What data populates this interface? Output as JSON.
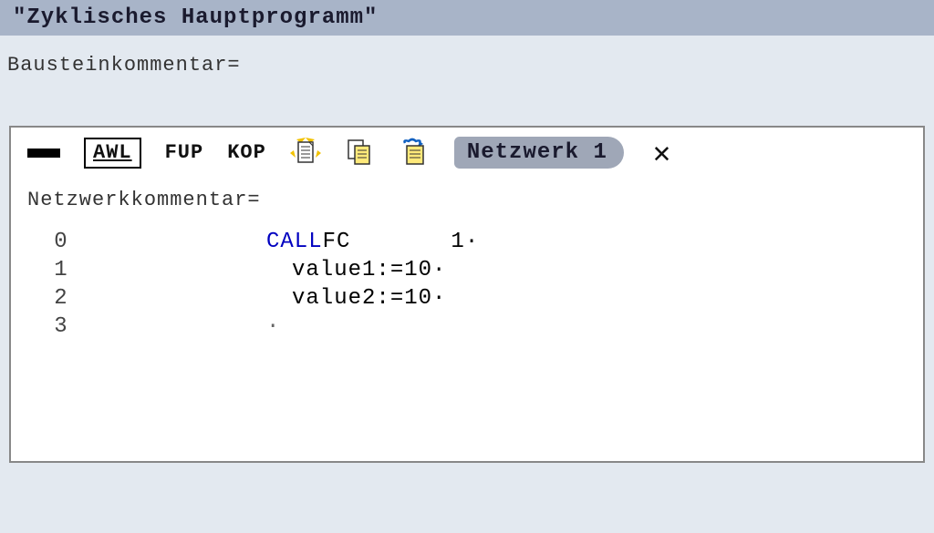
{
  "title": "\"Zyklisches Hauptprogramm\"",
  "block_comment_label": "Bausteinkommentar=",
  "block_comment_value": "",
  "toolbar": {
    "awl": "AWL",
    "fup": "FUP",
    "kop": "KOP",
    "network_tab": "Netzwerk 1",
    "close": "✕"
  },
  "network_comment_label": "Netzwerkkommentar=",
  "code": {
    "lines": [
      {
        "num": "0",
        "keyword": "CALL",
        "rest": " FC",
        "extra": "1·"
      },
      {
        "num": "1",
        "keyword": "",
        "rest": " value1:=10·",
        "extra": ""
      },
      {
        "num": "2",
        "keyword": "",
        "rest": " value2:=10·",
        "extra": ""
      },
      {
        "num": "3",
        "keyword": "",
        "rest": "·",
        "extra": ""
      }
    ]
  }
}
